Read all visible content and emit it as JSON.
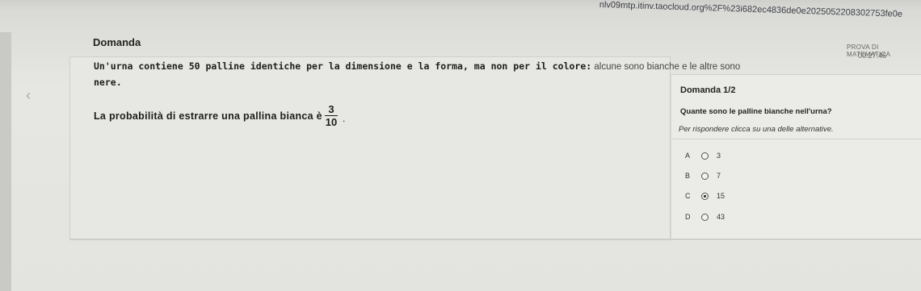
{
  "browser": {
    "url": "nlv09mtp.itinv.taocloud.org%2F%23i682ec4836de0e2025052208302753fe0e"
  },
  "header": {
    "title": "Domanda",
    "test_name": "PROVA DI MATEMATICA",
    "timer": "00:27:46"
  },
  "question": {
    "intro_bold": "Un'urna contiene 50 palline identiche per la dimensione e la forma, ma non per il colore:",
    "intro_rest": " alcune sono bianche e le altre sono",
    "intro_cont": "nere.",
    "probability_text": "La probabilità di estrarre una pallina bianca è",
    "fraction": {
      "numerator": "3",
      "denominator": "10"
    },
    "fraction_suffix": "."
  },
  "answer_panel": {
    "title": "Domanda 1/2",
    "question": "Quante sono le palline bianche nell'urna?",
    "instruction": "Per rispondere clicca su una delle alternative.",
    "options": [
      {
        "letter": "A",
        "value": "3",
        "selected": false
      },
      {
        "letter": "B",
        "value": "7",
        "selected": false
      },
      {
        "letter": "C",
        "value": "15",
        "selected": true
      },
      {
        "letter": "D",
        "value": "43",
        "selected": false
      }
    ]
  },
  "icons": {
    "back": "chevron-left-icon",
    "radio": "radio-button-icon"
  }
}
